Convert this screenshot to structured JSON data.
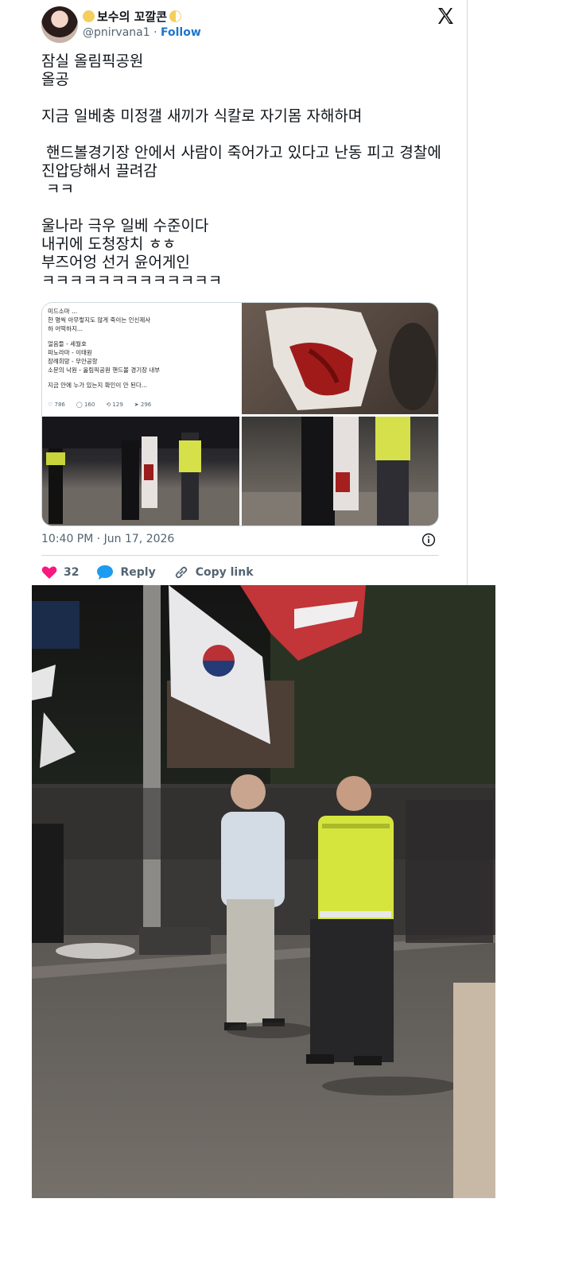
{
  "tweet": {
    "display_name": "보수의 꼬깔콘",
    "handle": "@pnirvana1",
    "separator": "·",
    "follow_label": "Follow",
    "body_lines": [
      "잠실 올림픽공원",
      "올공",
      "",
      "지금 일베충 미정갤 새끼가 식칼로 자기몸 자해하며",
      "",
      " 핸드볼경기장 안에서 사람이 죽어가고 있다고 난동 피고 경찰에 진압당해서 끌려감",
      " ㅋㅋ",
      "",
      "울나라 극우 일베 수준이다",
      "내귀에 도청장치 ㅎㅎ",
      "부즈어엉 선거 윤어게인",
      "ㅋㅋㅋㅋㅋㅋㅋㅋㅋㅋㅋㅋㅋ"
    ],
    "timestamp": "10:40 PM · Jun 17, 2026",
    "like_count": "32",
    "reply_label": "Reply",
    "copy_link_label": "Copy link"
  },
  "media_quote": {
    "lines": [
      "미드소마 ...",
      "한 명씩 아무렇지도 않게 죽이는 인신제사",
      "하 어떡하지...",
      "",
      "얼음들 - 세월호",
      "파노라마 - 이태원",
      "장례희망 - 무안공항",
      "소문의 낙원 - 올림픽공원 핸드볼 경기장 내부",
      "",
      "지금 안에 누가 있는지 확인이 안 된다..."
    ],
    "stats": [
      "786",
      "160",
      "129",
      "296"
    ]
  },
  "colors": {
    "accent": "#1d9bf0",
    "like": "#f91880",
    "text_secondary": "#536471",
    "divider": "#cfd9de"
  },
  "icons": {
    "brand": "x-logo-icon",
    "like": "heart-icon",
    "reply": "speech-bubble-icon",
    "copy_link": "link-icon",
    "info": "info-icon"
  }
}
